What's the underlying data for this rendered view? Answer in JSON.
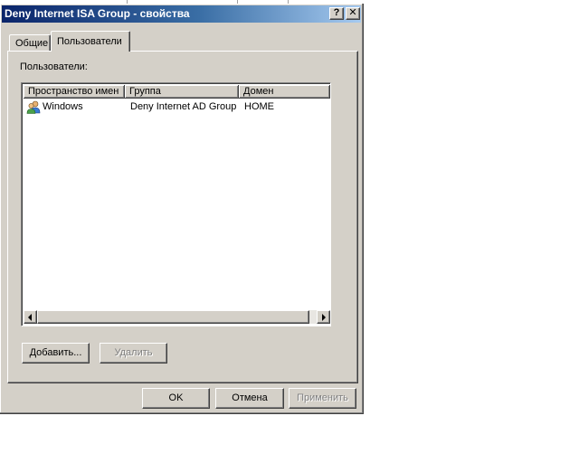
{
  "window": {
    "title": "Deny Internet ISA Group - свойства",
    "help_glyph": "?",
    "close_glyph": "✕"
  },
  "tabs": [
    {
      "label": "Общие",
      "selected": false
    },
    {
      "label": "Пользователи",
      "selected": true
    }
  ],
  "users_panel": {
    "label": "Пользователи:",
    "columns": [
      "Пространство имен",
      "Группа",
      "Домен"
    ],
    "rows": [
      {
        "namespace": "Windows",
        "group": "Deny Internet AD Group",
        "domain": "HOME",
        "icon": "users-group-icon"
      }
    ],
    "add_label": "Добавить...",
    "remove_label": "Удалить"
  },
  "footer": {
    "ok_label": "OK",
    "cancel_label": "Отмена",
    "apply_label": "Применить"
  },
  "colors": {
    "titlebar_start": "#0a246a",
    "titlebar_end": "#a6caf0",
    "face": "#d4d0c8"
  }
}
